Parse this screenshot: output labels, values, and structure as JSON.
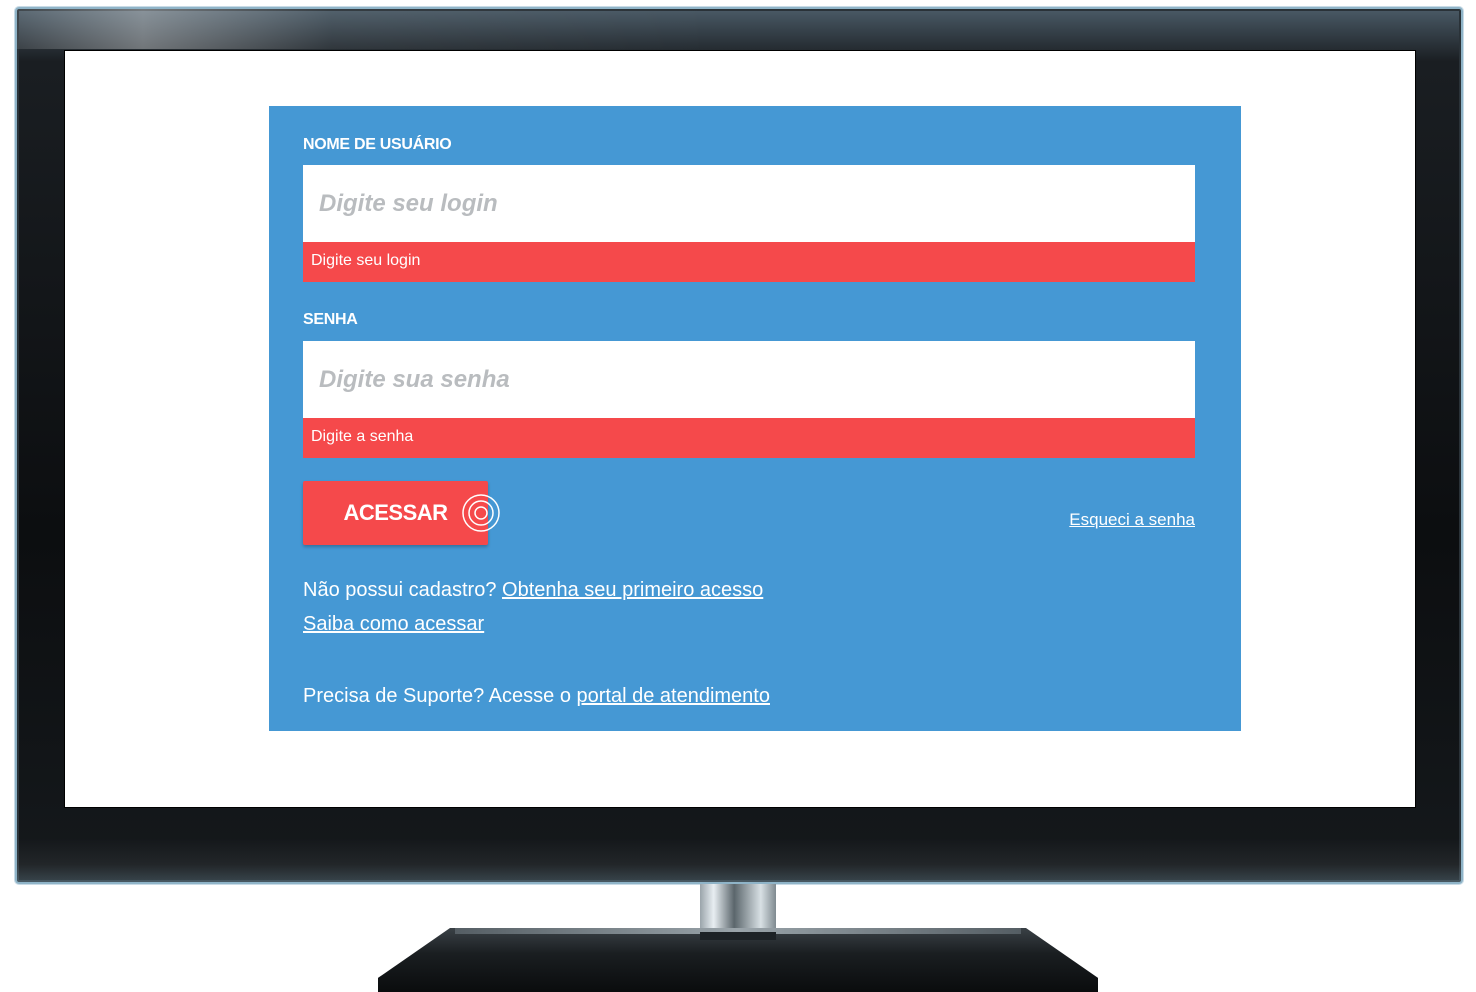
{
  "login": {
    "username": {
      "label": "NOME DE USUÁRIO",
      "placeholder": "Digite seu login",
      "error": "Digite seu login"
    },
    "password": {
      "label": "SENHA",
      "placeholder": "Digite sua senha",
      "error": "Digite a senha"
    },
    "submit_label": "ACESSAR",
    "forgot_password": "Esqueci a senha",
    "register": {
      "prompt": "Não possui cadastro?",
      "link": "Obtenha seu primeiro acesso"
    },
    "how_to_access": "Saiba como acessar",
    "support": {
      "prompt": "Precisa de Suporte? Acesse o",
      "link": "portal de atendimento"
    }
  },
  "colors": {
    "panel_background": "#4598d4",
    "error_red": "#f5494b",
    "text_white": "#ffffff",
    "placeholder_gray": "#b9bcbf"
  },
  "icons": {
    "cursor": "click-target-rings-icon"
  }
}
